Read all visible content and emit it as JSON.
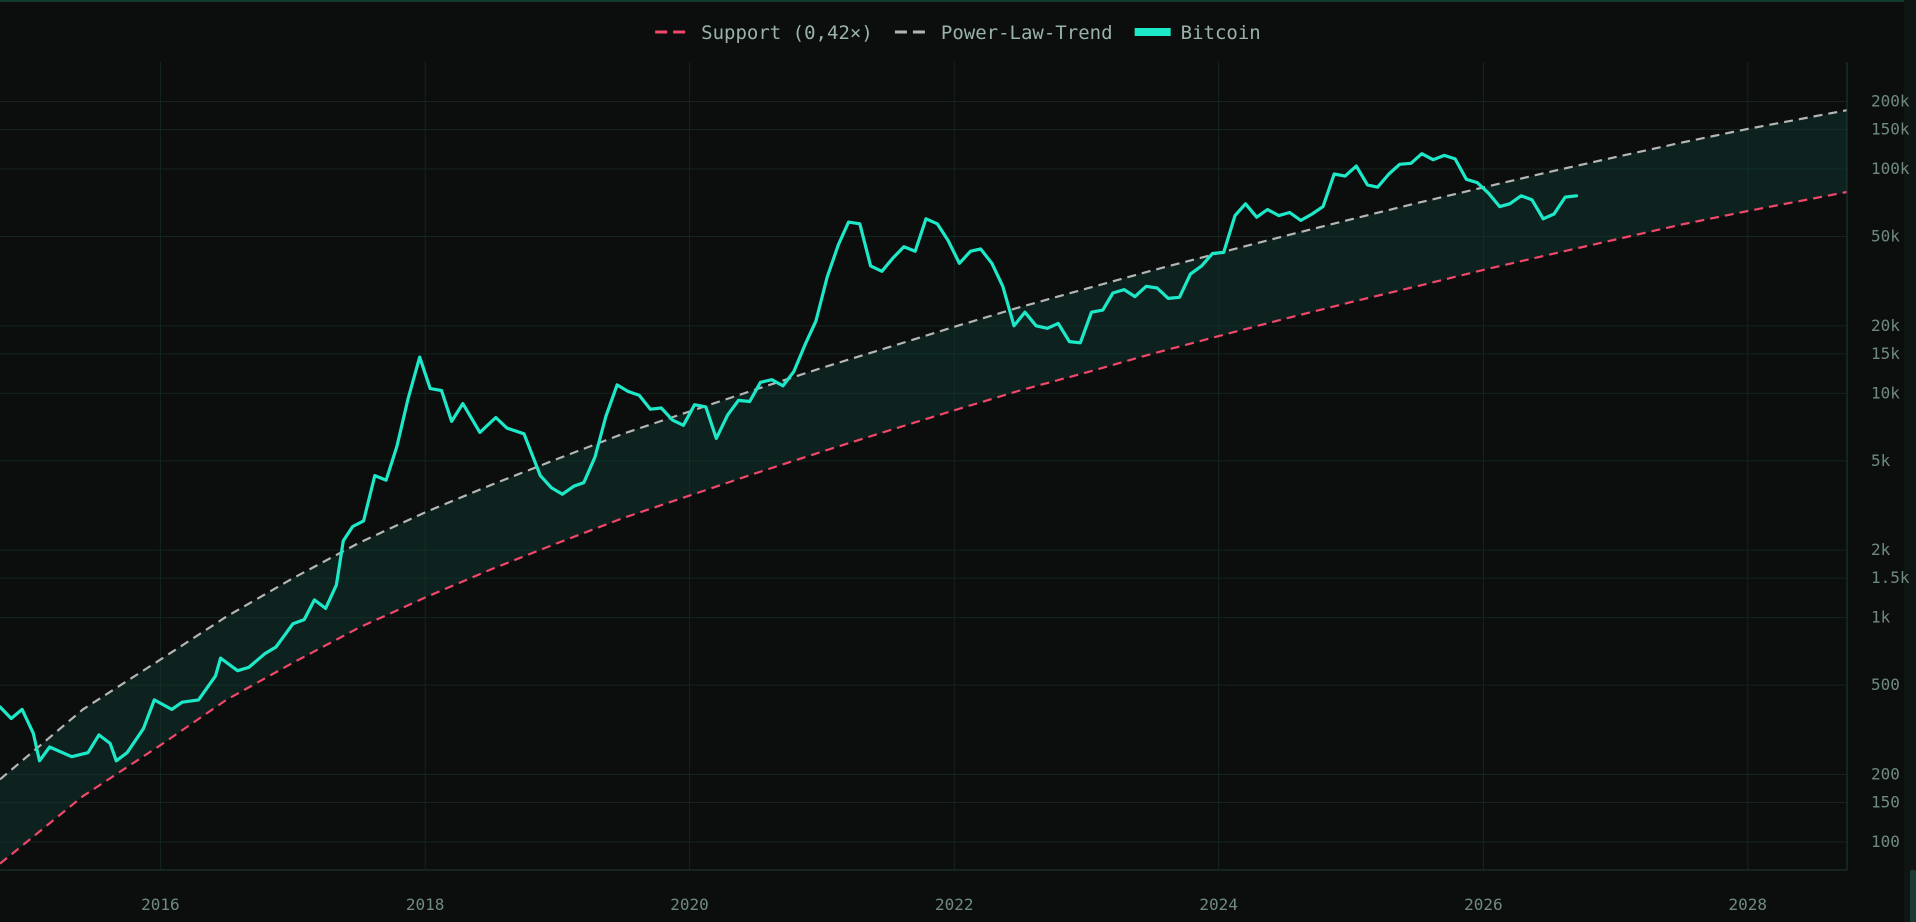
{
  "colors": {
    "background": "#0b0e0d",
    "grid": "#15241f",
    "axis_line": "#1d3a31",
    "support": "#f0476a",
    "trend": "#b5b5b5",
    "bitcoin": "#1de9c8",
    "band_fill": "#0f3b32",
    "legend_text": "#9ab3aa",
    "tick_text": "#6f8a80"
  },
  "chart_data": {
    "type": "line",
    "x_axis": {
      "type": "date",
      "range": [
        "2014-10-15",
        "2028-10-01"
      ],
      "tick_labels": [
        "2016",
        "2018",
        "2020",
        "2022",
        "2024",
        "2026",
        "2028"
      ]
    },
    "y_axis": {
      "scale": "log",
      "range": [
        75,
        300000
      ],
      "position": "right",
      "ticks": [
        {
          "value": 100,
          "label": "100"
        },
        {
          "value": 150,
          "label": "150"
        },
        {
          "value": 200,
          "label": "200"
        },
        {
          "value": 500,
          "label": "500"
        },
        {
          "value": 1000,
          "label": "1k"
        },
        {
          "value": 1500,
          "label": "1.5k"
        },
        {
          "value": 2000,
          "label": "2k"
        },
        {
          "value": 5000,
          "label": "5k"
        },
        {
          "value": 10000,
          "label": "10k"
        },
        {
          "value": 15000,
          "label": "15k"
        },
        {
          "value": 20000,
          "label": "20k"
        },
        {
          "value": 50000,
          "label": "50k"
        },
        {
          "value": 100000,
          "label": "100k"
        },
        {
          "value": 150000,
          "label": "150k"
        },
        {
          "value": 200000,
          "label": "200k"
        }
      ]
    },
    "grid": true,
    "legend": {
      "placement": "top-center",
      "entries": [
        {
          "label": "Support (0,42×)",
          "series": "support",
          "style": "dashed"
        },
        {
          "label": "Power-Law-Trend",
          "series": "trend",
          "style": "dashed"
        },
        {
          "label": "Bitcoin",
          "series": "bitcoin",
          "style": "solid"
        }
      ]
    },
    "band": {
      "between": [
        "support",
        "trend"
      ],
      "fill": "shaded"
    },
    "series": [
      {
        "name": "Support (0,42×)",
        "key": "support",
        "style": "dashed",
        "points": [
          [
            "2014-10-15",
            80
          ],
          [
            "2015-06-01",
            160
          ],
          [
            "2016-01-01",
            270
          ],
          [
            "2016-07-01",
            430
          ],
          [
            "2017-01-01",
            630
          ],
          [
            "2017-07-01",
            900
          ],
          [
            "2018-01-01",
            1230
          ],
          [
            "2018-07-01",
            1640
          ],
          [
            "2019-01-01",
            2150
          ],
          [
            "2019-07-01",
            2780
          ],
          [
            "2020-01-01",
            3500
          ],
          [
            "2020-07-01",
            4400
          ],
          [
            "2021-01-01",
            5500
          ],
          [
            "2021-07-01",
            6800
          ],
          [
            "2022-01-01",
            8400
          ],
          [
            "2022-07-01",
            10300
          ],
          [
            "2023-01-01",
            12400
          ],
          [
            "2023-07-01",
            15000
          ],
          [
            "2024-01-01",
            18000
          ],
          [
            "2024-07-01",
            21500
          ],
          [
            "2025-01-01",
            25500
          ],
          [
            "2025-07-01",
            30000
          ],
          [
            "2026-01-01",
            35500
          ],
          [
            "2026-07-01",
            41500
          ],
          [
            "2027-01-01",
            48500
          ],
          [
            "2027-07-01",
            56500
          ],
          [
            "2028-01-01",
            65000
          ],
          [
            "2028-10-01",
            79000
          ]
        ]
      },
      {
        "name": "Power-Law-Trend",
        "key": "trend",
        "style": "dashed",
        "points": [
          [
            "2014-10-15",
            190
          ],
          [
            "2015-06-01",
            390
          ],
          [
            "2016-01-01",
            650
          ],
          [
            "2016-07-01",
            1010
          ],
          [
            "2017-01-01",
            1500
          ],
          [
            "2017-07-01",
            2150
          ],
          [
            "2018-01-01",
            2950
          ],
          [
            "2018-07-01",
            3900
          ],
          [
            "2019-01-01",
            5100
          ],
          [
            "2019-07-01",
            6600
          ],
          [
            "2020-01-01",
            8300
          ],
          [
            "2020-07-01",
            10400
          ],
          [
            "2021-01-01",
            13000
          ],
          [
            "2021-07-01",
            16000
          ],
          [
            "2022-01-01",
            19800
          ],
          [
            "2022-07-01",
            24200
          ],
          [
            "2023-01-01",
            29300
          ],
          [
            "2023-07-01",
            35300
          ],
          [
            "2024-01-01",
            42200
          ],
          [
            "2024-07-01",
            50300
          ],
          [
            "2025-01-01",
            59700
          ],
          [
            "2025-07-01",
            70500
          ],
          [
            "2026-01-01",
            82800
          ],
          [
            "2026-07-01",
            97000
          ],
          [
            "2027-01-01",
            113000
          ],
          [
            "2027-07-01",
            131000
          ],
          [
            "2028-01-01",
            151000
          ],
          [
            "2028-10-01",
            183000
          ]
        ]
      },
      {
        "name": "Bitcoin",
        "key": "bitcoin",
        "style": "solid",
        "points": [
          [
            "2014-10-15",
            400
          ],
          [
            "2014-11-15",
            355
          ],
          [
            "2014-12-15",
            390
          ],
          [
            "2015-01-15",
            305
          ],
          [
            "2015-02-01",
            230
          ],
          [
            "2015-03-01",
            265
          ],
          [
            "2015-05-01",
            240
          ],
          [
            "2015-06-15",
            250
          ],
          [
            "2015-07-15",
            300
          ],
          [
            "2015-08-15",
            275
          ],
          [
            "2015-09-01",
            230
          ],
          [
            "2015-10-01",
            250
          ],
          [
            "2015-11-15",
            320
          ],
          [
            "2015-12-15",
            430
          ],
          [
            "2016-02-01",
            390
          ],
          [
            "2016-03-01",
            420
          ],
          [
            "2016-04-15",
            430
          ],
          [
            "2016-06-01",
            550
          ],
          [
            "2016-06-15",
            660
          ],
          [
            "2016-08-01",
            580
          ],
          [
            "2016-09-01",
            600
          ],
          [
            "2016-10-15",
            690
          ],
          [
            "2016-11-15",
            740
          ],
          [
            "2017-01-01",
            940
          ],
          [
            "2017-02-01",
            980
          ],
          [
            "2017-03-01",
            1200
          ],
          [
            "2017-04-01",
            1100
          ],
          [
            "2017-05-01",
            1400
          ],
          [
            "2017-05-20",
            2200
          ],
          [
            "2017-06-15",
            2550
          ],
          [
            "2017-07-15",
            2700
          ],
          [
            "2017-08-15",
            4300
          ],
          [
            "2017-09-15",
            4100
          ],
          [
            "2017-10-15",
            5800
          ],
          [
            "2017-11-15",
            9500
          ],
          [
            "2017-12-17",
            14500
          ],
          [
            "2018-01-15",
            10500
          ],
          [
            "2018-02-15",
            10300
          ],
          [
            "2018-03-15",
            7500
          ],
          [
            "2018-04-15",
            9000
          ],
          [
            "2018-06-01",
            6700
          ],
          [
            "2018-07-15",
            7800
          ],
          [
            "2018-08-15",
            7000
          ],
          [
            "2018-10-01",
            6600
          ],
          [
            "2018-11-15",
            4300
          ],
          [
            "2018-12-15",
            3800
          ],
          [
            "2019-01-15",
            3550
          ],
          [
            "2019-02-15",
            3850
          ],
          [
            "2019-03-15",
            4000
          ],
          [
            "2019-04-15",
            5200
          ],
          [
            "2019-05-15",
            7900
          ],
          [
            "2019-06-15",
            10900
          ],
          [
            "2019-07-15",
            10200
          ],
          [
            "2019-08-15",
            9800
          ],
          [
            "2019-09-15",
            8500
          ],
          [
            "2019-10-15",
            8600
          ],
          [
            "2019-11-15",
            7600
          ],
          [
            "2019-12-15",
            7200
          ],
          [
            "2020-01-15",
            8900
          ],
          [
            "2020-02-15",
            8700
          ],
          [
            "2020-03-15",
            6300
          ],
          [
            "2020-04-15",
            8000
          ],
          [
            "2020-05-15",
            9300
          ],
          [
            "2020-06-15",
            9200
          ],
          [
            "2020-07-15",
            11200
          ],
          [
            "2020-08-15",
            11500
          ],
          [
            "2020-09-15",
            10800
          ],
          [
            "2020-10-15",
            12500
          ],
          [
            "2020-11-15",
            16500
          ],
          [
            "2020-12-15",
            21000
          ],
          [
            "2021-01-15",
            33000
          ],
          [
            "2021-02-15",
            46000
          ],
          [
            "2021-03-15",
            58000
          ],
          [
            "2021-04-15",
            57000
          ],
          [
            "2021-05-15",
            37000
          ],
          [
            "2021-06-15",
            35000
          ],
          [
            "2021-07-15",
            40000
          ],
          [
            "2021-08-15",
            45000
          ],
          [
            "2021-09-15",
            43000
          ],
          [
            "2021-10-15",
            60000
          ],
          [
            "2021-11-15",
            57000
          ],
          [
            "2021-12-15",
            48000
          ],
          [
            "2022-01-15",
            38000
          ],
          [
            "2022-02-15",
            43000
          ],
          [
            "2022-03-15",
            44000
          ],
          [
            "2022-04-15",
            38000
          ],
          [
            "2022-05-15",
            30000
          ],
          [
            "2022-06-15",
            20000
          ],
          [
            "2022-07-15",
            23000
          ],
          [
            "2022-08-15",
            20000
          ],
          [
            "2022-09-15",
            19500
          ],
          [
            "2022-10-15",
            20500
          ],
          [
            "2022-11-15",
            17000
          ],
          [
            "2022-12-15",
            16800
          ],
          [
            "2023-01-15",
            23000
          ],
          [
            "2023-02-15",
            23500
          ],
          [
            "2023-03-15",
            28000
          ],
          [
            "2023-04-15",
            29000
          ],
          [
            "2023-05-15",
            27000
          ],
          [
            "2023-06-15",
            30000
          ],
          [
            "2023-07-15",
            29500
          ],
          [
            "2023-08-15",
            26500
          ],
          [
            "2023-09-15",
            26800
          ],
          [
            "2023-10-15",
            34000
          ],
          [
            "2023-11-15",
            37000
          ],
          [
            "2023-12-15",
            42000
          ],
          [
            "2024-01-15",
            42500
          ],
          [
            "2024-02-15",
            62000
          ],
          [
            "2024-03-15",
            70000
          ],
          [
            "2024-04-15",
            61000
          ],
          [
            "2024-05-15",
            66000
          ],
          [
            "2024-06-15",
            62000
          ],
          [
            "2024-07-15",
            64000
          ],
          [
            "2024-08-15",
            59000
          ],
          [
            "2024-09-15",
            63000
          ],
          [
            "2024-10-15",
            68000
          ],
          [
            "2024-11-15",
            95000
          ],
          [
            "2024-12-15",
            93000
          ],
          [
            "2025-01-15",
            103000
          ],
          [
            "2025-02-15",
            85000
          ],
          [
            "2025-03-15",
            83000
          ],
          [
            "2025-04-15",
            95000
          ],
          [
            "2025-05-15",
            105000
          ],
          [
            "2025-06-15",
            106000
          ],
          [
            "2025-07-15",
            117000
          ],
          [
            "2025-08-15",
            110000
          ],
          [
            "2025-09-15",
            115000
          ],
          [
            "2025-10-15",
            111000
          ],
          [
            "2025-11-15",
            90000
          ],
          [
            "2025-12-15",
            87000
          ],
          [
            "2026-01-15",
            78000
          ],
          [
            "2026-02-15",
            68000
          ],
          [
            "2026-03-15",
            70000
          ],
          [
            "2026-04-15",
            76000
          ],
          [
            "2026-05-15",
            73000
          ],
          [
            "2026-06-15",
            60000
          ],
          [
            "2026-07-15",
            63000
          ],
          [
            "2026-08-15",
            75000
          ],
          [
            "2026-09-15",
            76000
          ]
        ]
      }
    ]
  }
}
